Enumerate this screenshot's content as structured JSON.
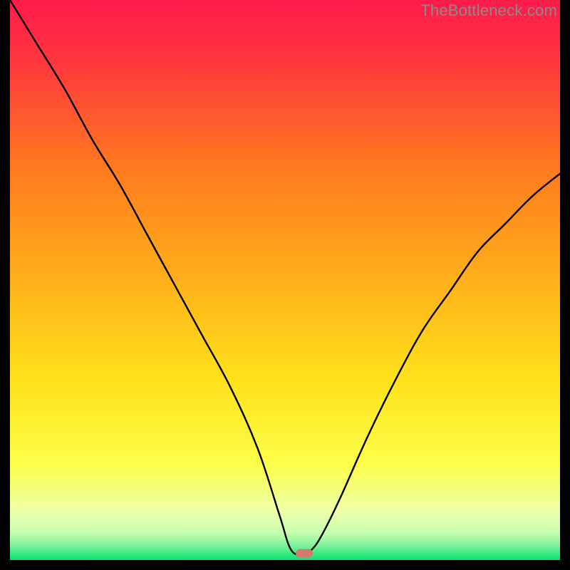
{
  "watermark": "TheBottleneck.com",
  "chart_data": {
    "type": "line",
    "title": "",
    "xlabel": "",
    "ylabel": "",
    "xlim": [
      0,
      100
    ],
    "ylim": [
      0,
      100
    ],
    "grid": false,
    "legend": false,
    "background_gradient": {
      "top_color": "#ff1a4b",
      "mid_color_1": "#ff7a1f",
      "mid_color_2": "#ffe21a",
      "lower_color": "#f6ff9a",
      "bottom_color": "#06e36e"
    },
    "marker": {
      "x": 53.5,
      "y": 1.2,
      "color": "#d67a6d"
    },
    "series": [
      {
        "name": "bottleneck-curve",
        "x": [
          0,
          5,
          10,
          15,
          20,
          25,
          30,
          35,
          40,
          45,
          49,
          51,
          53,
          55,
          57,
          60,
          65,
          70,
          75,
          80,
          85,
          90,
          95,
          100
        ],
        "values": [
          100,
          92,
          84,
          75,
          67,
          58,
          49,
          40,
          31,
          20,
          8,
          2,
          1,
          2,
          5,
          11,
          22,
          32,
          41,
          48,
          55,
          60,
          65,
          69
        ]
      }
    ]
  }
}
